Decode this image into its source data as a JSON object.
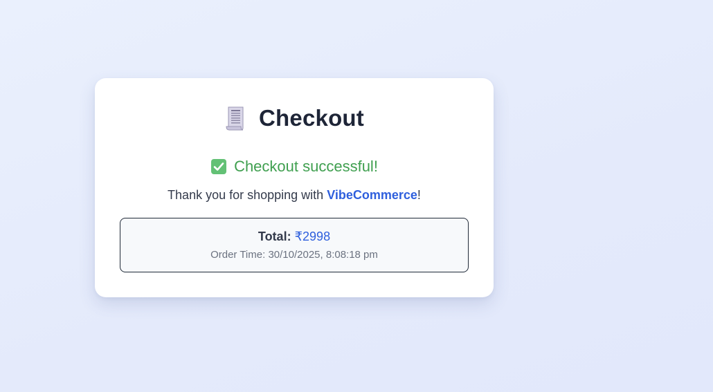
{
  "checkout": {
    "title": "Checkout",
    "title_icon": "receipt-icon",
    "success_icon": "check-box-icon",
    "success_message": "Checkout successful!",
    "thanks_prefix": "Thank you for shopping with ",
    "brand": "VibeCommerce",
    "thanks_suffix": "!",
    "total_label": "Total:",
    "total_value": "₹2998",
    "order_time_label": "Order Time:",
    "order_time_value": "30/10/2025, 8:08:18 pm"
  },
  "colors": {
    "success": "#3f9f4f",
    "brand": "#2e5fdd",
    "title": "#1e2537",
    "muted": "#6b7280"
  }
}
